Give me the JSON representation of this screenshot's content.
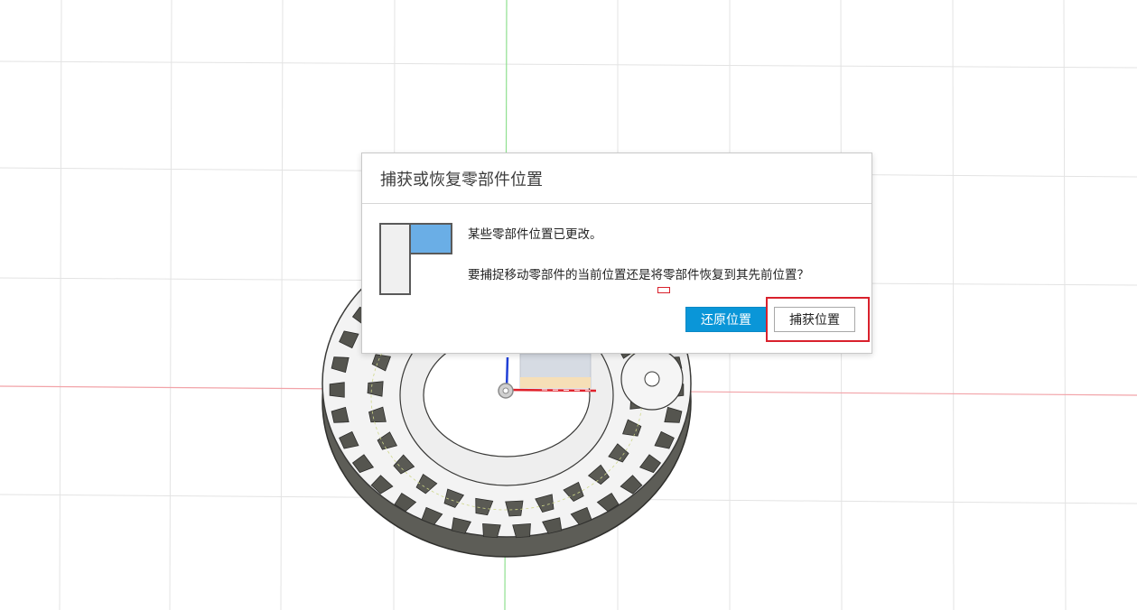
{
  "dialog": {
    "title": "捕获或恢复零部件位置",
    "message_line1": "某些零部件位置已更改。",
    "message_line2": "要捕捉移动零部件的当前位置还是将零部件恢复到其先前位置？",
    "icon": "component-position-icon",
    "buttons": {
      "restore_label": "还原位置",
      "capture_label": "捕获位置"
    }
  },
  "viewport": {
    "model": "gear-assembly",
    "axis_colors": {
      "x_axis": "#e8505a",
      "y_axis": "#5ad25a",
      "z_axis": "#1f3fd6"
    },
    "grid_color": "#e3e3e3",
    "accent_color": "#0a96d8",
    "highlight_color": "#d9212c"
  }
}
